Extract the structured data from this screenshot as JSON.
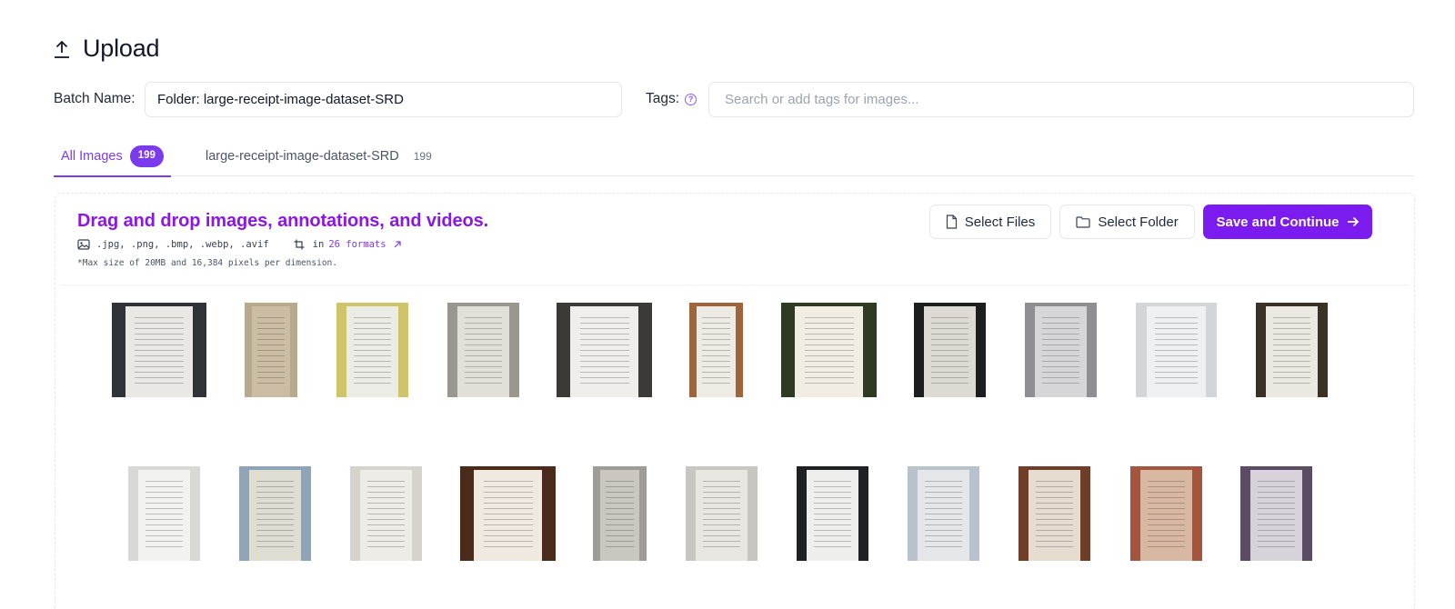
{
  "page": {
    "title": "Upload"
  },
  "batch": {
    "label": "Batch Name:",
    "value": "Folder: large-receipt-image-dataset-SRD"
  },
  "tags": {
    "label": "Tags:",
    "placeholder": "Search or add tags for images..."
  },
  "tabs": [
    {
      "label": "All Images",
      "count": "199",
      "active": true
    },
    {
      "label": "large-receipt-image-dataset-SRD",
      "count": "199",
      "active": false
    }
  ],
  "dropzone": {
    "title": "Drag and drop images, annotations, and videos.",
    "extensions": ".jpg, .png, .bmp, .webp, .avif",
    "formats_prefix": "in",
    "formats_link": "26 formats",
    "max_size": "*Max size of 20MB and 16,384 pixels per dimension."
  },
  "buttons": {
    "select_files": "Select Files",
    "select_folder": "Select Folder",
    "save_continue": "Save and Continue"
  },
  "icons": {
    "upload": "upload-icon",
    "help": "help-circle-icon",
    "image": "image-icon",
    "crop": "crop-icon",
    "external": "arrow-up-right-icon",
    "file": "file-icon",
    "folder": "folder-icon",
    "arrow": "arrow-right-icon"
  },
  "colors": {
    "accent": "#7c3aed",
    "title": "#8b16e8",
    "primary_button": "#7c1bf0"
  },
  "thumbnails": [
    {
      "name": "receipt-thumbnail-1",
      "bg": "#2f3338",
      "paper": "#e9e8e4"
    },
    {
      "name": "receipt-thumbnail-2",
      "bg": "#b8a88c",
      "paper": "#cbbda3"
    },
    {
      "name": "receipt-thumbnail-3",
      "bg": "#cfc46a",
      "paper": "#ecece6"
    },
    {
      "name": "receipt-thumbnail-4",
      "bg": "#9a9690",
      "paper": "#e2dfd8"
    },
    {
      "name": "receipt-thumbnail-5",
      "bg": "#3c3a37",
      "paper": "#f0eeea"
    },
    {
      "name": "receipt-thumbnail-6",
      "bg": "#a0643a",
      "paper": "#eeeae4"
    },
    {
      "name": "receipt-thumbnail-7",
      "bg": "#2f3a22",
      "paper": "#f1ede2"
    },
    {
      "name": "receipt-thumbnail-8",
      "bg": "#1c1d1f",
      "paper": "#dcdad2"
    },
    {
      "name": "receipt-thumbnail-9",
      "bg": "#8f8e92",
      "paper": "#d6d5d8"
    },
    {
      "name": "receipt-thumbnail-10",
      "bg": "#d3d6d9",
      "paper": "#eef0f2"
    },
    {
      "name": "receipt-thumbnail-11",
      "bg": "#3a3225",
      "paper": "#ebe8e1"
    },
    {
      "name": "receipt-thumbnail-12",
      "bg": "#d8d8d4",
      "paper": "#f2f2ef"
    },
    {
      "name": "receipt-thumbnail-13",
      "bg": "#8ea4b8",
      "paper": "#dfdcd2"
    },
    {
      "name": "receipt-thumbnail-14",
      "bg": "#d5d3cc",
      "paper": "#eeece6"
    },
    {
      "name": "receipt-thumbnail-15",
      "bg": "#4a2a1a",
      "paper": "#efe9df"
    },
    {
      "name": "receipt-thumbnail-16",
      "bg": "#9d9c96",
      "paper": "#c9c7c0"
    },
    {
      "name": "receipt-thumbnail-17",
      "bg": "#c8c6c0",
      "paper": "#e8e6e0"
    },
    {
      "name": "receipt-thumbnail-18",
      "bg": "#1f2023",
      "paper": "#eeeeec"
    },
    {
      "name": "receipt-thumbnail-19",
      "bg": "#b7c2cc",
      "paper": "#e4e6ea"
    },
    {
      "name": "receipt-thumbnail-20",
      "bg": "#6e3e28",
      "paper": "#e6ddd1"
    },
    {
      "name": "receipt-thumbnail-21",
      "bg": "#a5553d",
      "paper": "#d8b8a2"
    },
    {
      "name": "receipt-thumbnail-22",
      "bg": "#5c4c63",
      "paper": "#d8d2da"
    }
  ]
}
